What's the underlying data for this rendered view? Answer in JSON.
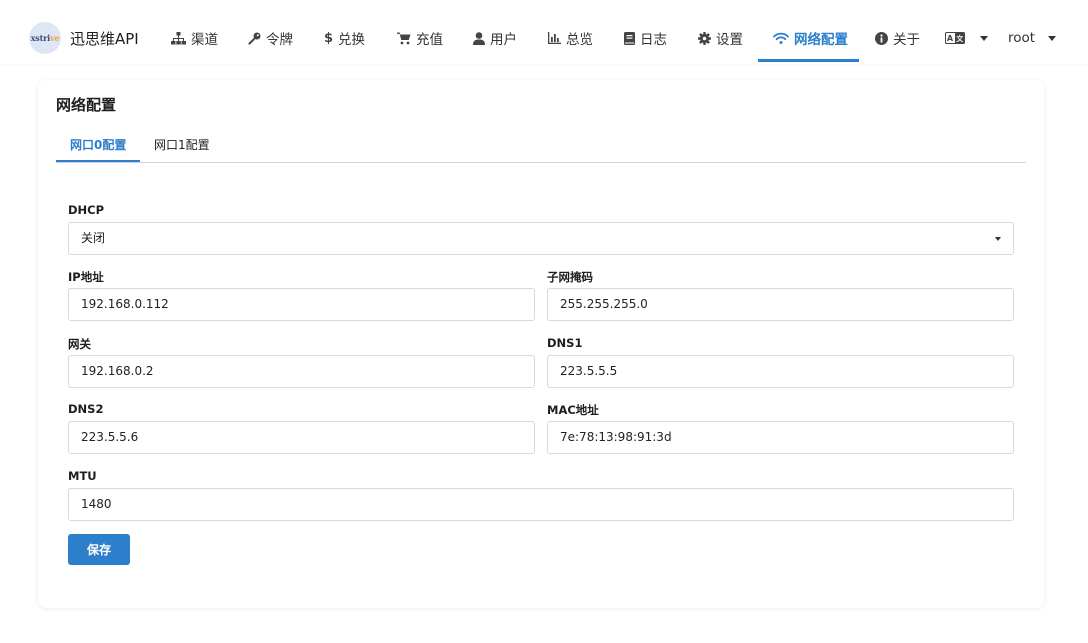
{
  "brand": {
    "logo_text_main": "xstri",
    "logo_text_accent": "ve",
    "name": "迅思维API"
  },
  "nav": {
    "items": [
      {
        "label": "渠道",
        "icon": "sitemap-icon"
      },
      {
        "label": "令牌",
        "icon": "key-icon"
      },
      {
        "label": "兑换",
        "icon": "dollar-icon"
      },
      {
        "label": "充值",
        "icon": "cart-icon"
      },
      {
        "label": "用户",
        "icon": "user-icon"
      },
      {
        "label": "总览",
        "icon": "chart-icon"
      },
      {
        "label": "日志",
        "icon": "book-icon"
      },
      {
        "label": "设置",
        "icon": "gear-icon"
      },
      {
        "label": "网络配置",
        "icon": "wifi-icon"
      },
      {
        "label": "关于",
        "icon": "info-icon"
      }
    ],
    "active": "网络配置",
    "language_icon": "language-icon",
    "user": "root"
  },
  "colors": {
    "accent": "#2d7fcc"
  },
  "page": {
    "title": "网络配置",
    "tabs": [
      "网口0配置",
      "网口1配置"
    ],
    "active_tab": "网口0配置",
    "form": {
      "dhcp": {
        "label": "DHCP",
        "value": "关闭"
      },
      "ip": {
        "label": "IP地址",
        "value": "192.168.0.112"
      },
      "netmask": {
        "label": "子网掩码",
        "value": "255.255.255.0"
      },
      "gateway": {
        "label": "网关",
        "value": "192.168.0.2"
      },
      "dns1": {
        "label": "DNS1",
        "value": "223.5.5.5"
      },
      "dns2": {
        "label": "DNS2",
        "value": "223.5.5.6"
      },
      "mac": {
        "label": "MAC地址",
        "value": "7e:78:13:98:91:3d"
      },
      "mtu": {
        "label": "MTU",
        "value": "1480"
      }
    },
    "save_label": "保存"
  }
}
